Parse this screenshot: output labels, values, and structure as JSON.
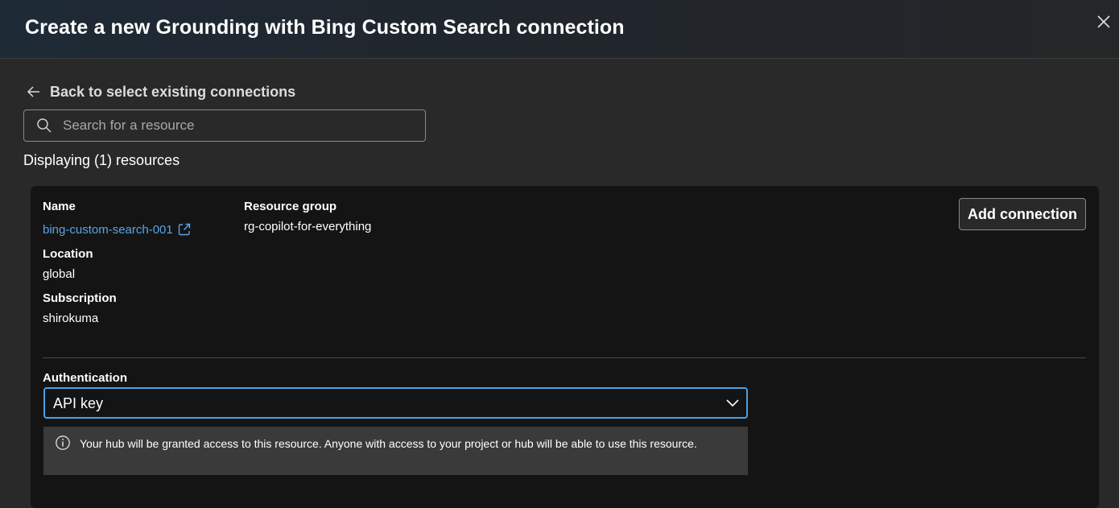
{
  "dialog": {
    "title": "Create a new Grounding with Bing Custom Search connection",
    "close_icon": "close-icon"
  },
  "back_link": {
    "label": "Back to select existing connections",
    "icon": "arrow-left-icon"
  },
  "search": {
    "placeholder": "Search for a resource",
    "value": "",
    "icon": "search-icon"
  },
  "results": {
    "count_text": "Displaying (1) resources"
  },
  "resource_card": {
    "name_label": "Name",
    "name_value": "bing-custom-search-001",
    "name_link_icon": "external-link-icon",
    "resource_group_label": "Resource group",
    "resource_group_value": "rg-copilot-for-everything",
    "location_label": "Location",
    "location_value": "global",
    "subscription_label": "Subscription",
    "subscription_value": "shirokuma",
    "add_connection_label": "Add connection",
    "authentication_label": "Authentication",
    "authentication_value": "API key",
    "info_icon": "info-icon",
    "info_message": "Your hub will be granted access to this resource. Anyone with access to your project or hub will be able to use this resource."
  },
  "colors": {
    "background": "#292929",
    "card_background": "#141414",
    "link": "#5aa5e6",
    "focus_border": "#4aa0e6",
    "info_bar": "#3a3a3a"
  }
}
